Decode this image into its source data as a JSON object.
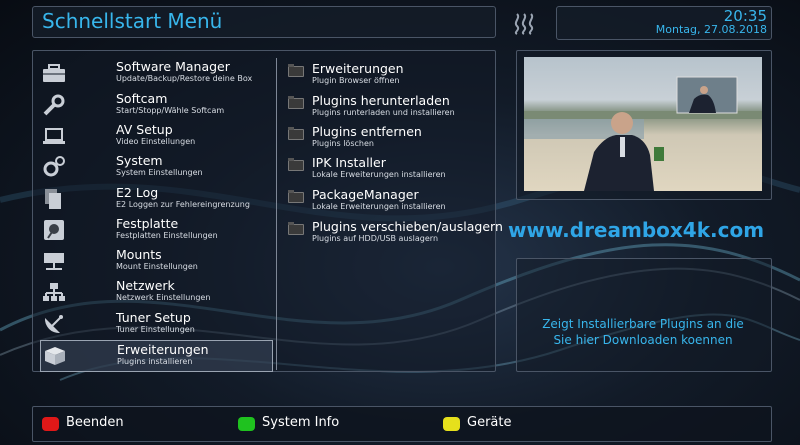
{
  "header": {
    "title": "Schnellstart Menü"
  },
  "clock": {
    "time": "20:35",
    "date": "Montag, 27.08.2018"
  },
  "left_menu": [
    {
      "label": "Software Manager",
      "sub": "Update/Backup/Restore deine Box",
      "icon": "toolbox-icon"
    },
    {
      "label": "Softcam",
      "sub": "Start/Stopp/Wähle Softcam",
      "icon": "wrench-icon"
    },
    {
      "label": "AV Setup",
      "sub": "Video Einstellungen",
      "icon": "laptop-icon"
    },
    {
      "label": "System",
      "sub": "System Einstellungen",
      "icon": "gears-icon"
    },
    {
      "label": "E2 Log",
      "sub": "E2 Loggen zur Fehlereingrenzung",
      "icon": "documents-icon"
    },
    {
      "label": "Festplatte",
      "sub": "Festplatten Einstellungen",
      "icon": "harddisk-icon"
    },
    {
      "label": "Mounts",
      "sub": "Mount Einstellungen",
      "icon": "network-drive-icon"
    },
    {
      "label": "Netzwerk",
      "sub": "Netzwerk Einstellungen",
      "icon": "network-icon"
    },
    {
      "label": "Tuner Setup",
      "sub": "Tuner Einstellungen",
      "icon": "satellite-dish-icon"
    },
    {
      "label": "Erweiterungen",
      "sub": "Plugins installieren",
      "icon": "box-icon",
      "selected": true
    }
  ],
  "right_menu": [
    {
      "label": "Erweiterungen",
      "sub": "Plugin Browser öffnen"
    },
    {
      "label": "Plugins herunterladen",
      "sub": "Plugins runterladen und installieren"
    },
    {
      "label": "Plugins entfernen",
      "sub": "Plugins löschen"
    },
    {
      "label": "IPK Installer",
      "sub": "Lokale Erweiterungen installieren"
    },
    {
      "label": "PackageManager",
      "sub": "Lokale Erweiterungen installieren"
    },
    {
      "label": "Plugins verschieben/auslagern",
      "sub": "Plugins auf HDD/USB auslagern"
    }
  ],
  "watermark": "www.dreambox4k.com",
  "info": {
    "line1": "Zeigt Installierbare Plugins an die",
    "line2": "Sie hier Downloaden koennen"
  },
  "footer": {
    "red_label": "Beenden",
    "green_label": "System Info",
    "yellow_label": "Geräte",
    "colors": {
      "red": "#e01818",
      "green": "#1fc21f",
      "yellow": "#e6e01c"
    }
  },
  "accent_color": "#38b6ec"
}
